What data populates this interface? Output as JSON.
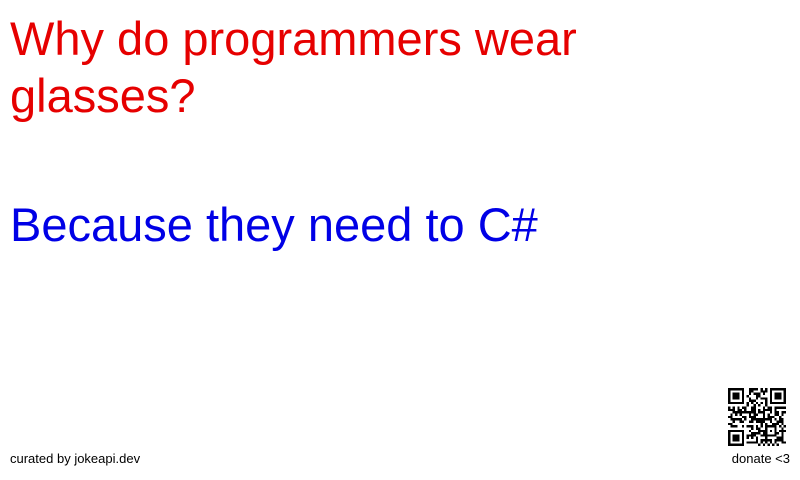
{
  "joke": {
    "setup": "Why do programmers wear glasses?",
    "delivery": "Because they need to C#"
  },
  "footer": {
    "credit": "curated by jokeapi.dev",
    "donate": "donate <3"
  },
  "colors": {
    "setup": "#e60000",
    "delivery": "#0000e6",
    "footer": "#000000",
    "background": "#ffffff"
  },
  "icons": {
    "qr": "qr-code-icon"
  }
}
